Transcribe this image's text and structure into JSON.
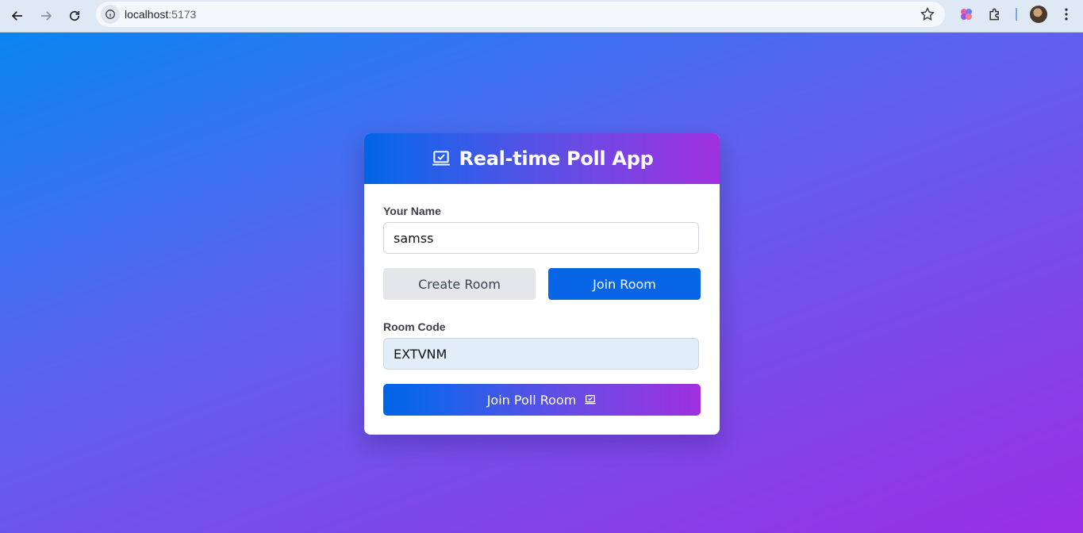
{
  "browser": {
    "url_host": "localhost",
    "url_port": ":5173"
  },
  "header": {
    "title": "Real-time Poll App",
    "icon": "laptop-check-icon"
  },
  "form": {
    "name_label": "Your Name",
    "name_value": "samss",
    "create_room_label": "Create Room",
    "join_room_label": "Join Room",
    "room_code_label": "Room Code",
    "room_code_value": "EXTVNM",
    "submit_label": "Join Poll Room"
  },
  "colors": {
    "gradient_start": "#0a85f0",
    "gradient_end": "#9a2fe3",
    "primary_button": "#0866e6",
    "secondary_button": "#e4e6ea"
  }
}
